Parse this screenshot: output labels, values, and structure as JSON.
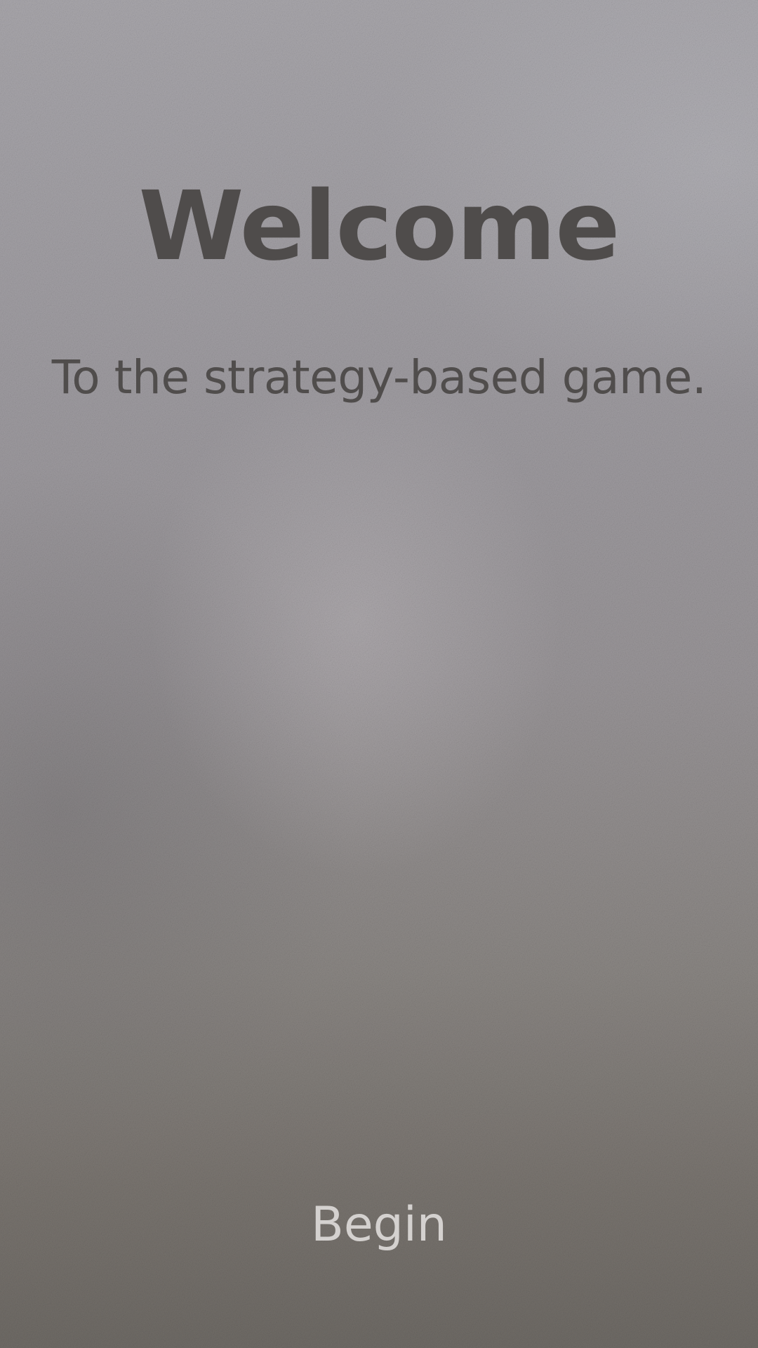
{
  "welcome_screen": {
    "title": "Welcome",
    "subtitle": "To the strategy-based game.",
    "begin_label": "Begin"
  },
  "colors": {
    "title_text": "#4f4c4b",
    "subtitle_text": "#504d4c",
    "begin_text": "#d4d1cf",
    "background_top": "#aaa8ad",
    "background_bottom": "#6f6b66"
  }
}
